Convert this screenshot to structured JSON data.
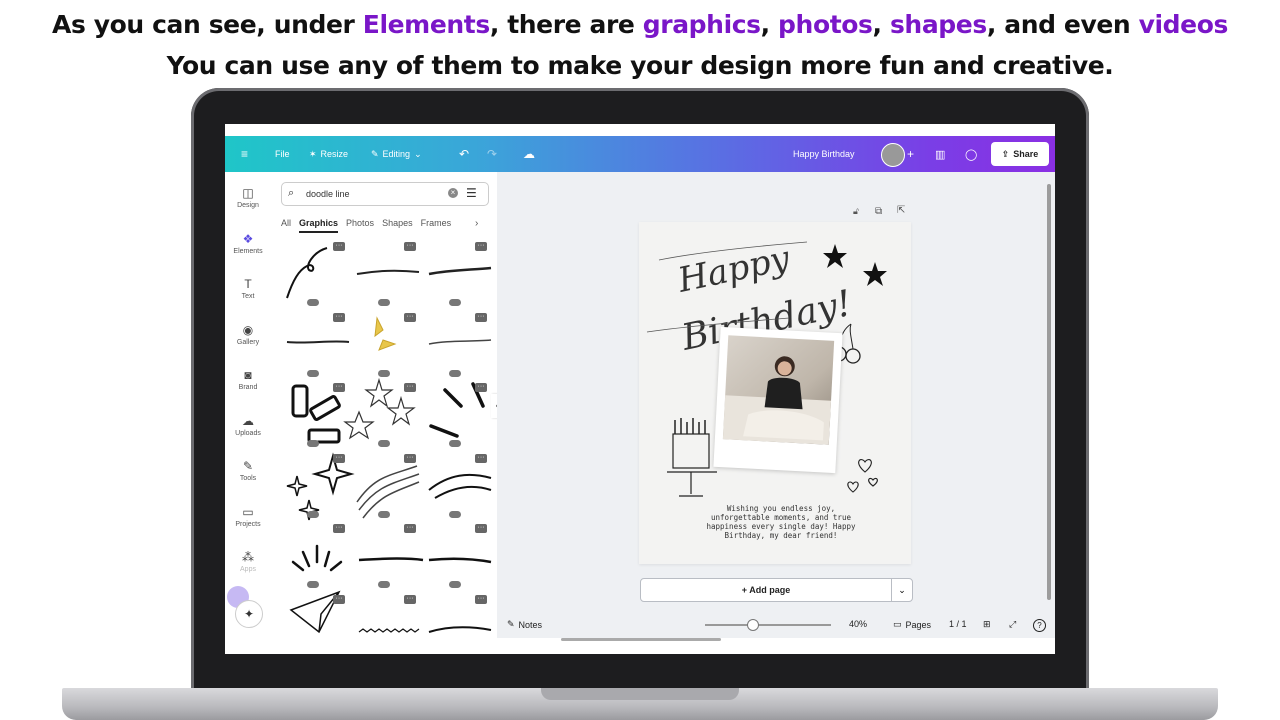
{
  "caption": {
    "line1": [
      {
        "text": "As you can see, under ",
        "highlight": false
      },
      {
        "text": "Elements",
        "highlight": true
      },
      {
        "text": ", there are ",
        "highlight": false
      },
      {
        "text": "graphics",
        "highlight": true
      },
      {
        "text": ", ",
        "highlight": false
      },
      {
        "text": "photos",
        "highlight": true
      },
      {
        "text": ", ",
        "highlight": false
      },
      {
        "text": "shapes",
        "highlight": true
      },
      {
        "text": ", and even ",
        "highlight": false
      },
      {
        "text": "videos",
        "highlight": true
      }
    ],
    "line2": "You can use any of them to make your design more fun and creative.",
    "highlight_color": "#7a16c8"
  },
  "topbar": {
    "menu_icon": "hamburger-icon",
    "file": "File",
    "resize": "Resize",
    "editing": "Editing",
    "title": "Happy Birthday",
    "share": "Share",
    "gradient": [
      "#1fc6c8",
      "#5a6ee3",
      "#8a2fe3"
    ]
  },
  "rail": [
    {
      "label": "Design",
      "icon": "layout-icon",
      "glyph": "◫"
    },
    {
      "label": "Elements",
      "icon": "shapes-icon",
      "glyph": "❖"
    },
    {
      "label": "Text",
      "icon": "text-icon",
      "glyph": "T"
    },
    {
      "label": "Gallery",
      "icon": "camera-icon",
      "glyph": "◉"
    },
    {
      "label": "Brand",
      "icon": "brand-icon",
      "glyph": "◙"
    },
    {
      "label": "Uploads",
      "icon": "cloud-upload-icon",
      "glyph": "☁"
    },
    {
      "label": "Tools",
      "icon": "pen-icon",
      "glyph": "✎"
    },
    {
      "label": "Projects",
      "icon": "folder-icon",
      "glyph": "▭"
    },
    {
      "label": "Apps",
      "icon": "apps-icon",
      "glyph": "⁂"
    }
  ],
  "panel": {
    "search_value": "doodle line",
    "tabs": [
      "All",
      "Graphics",
      "Photos",
      "Shapes",
      "Frames"
    ],
    "active_tab": "Graphics"
  },
  "canvas": {
    "wish_lines": [
      "Wishing you endless joy,",
      "unforgettable moments, and true",
      "happiness every single day! Happy",
      "Birthday, my dear friend!"
    ],
    "add_page": "+ Add page"
  },
  "bottombar": {
    "notes": "Notes",
    "zoom": "40%",
    "pages": "Pages",
    "page_count": "1 / 1"
  }
}
